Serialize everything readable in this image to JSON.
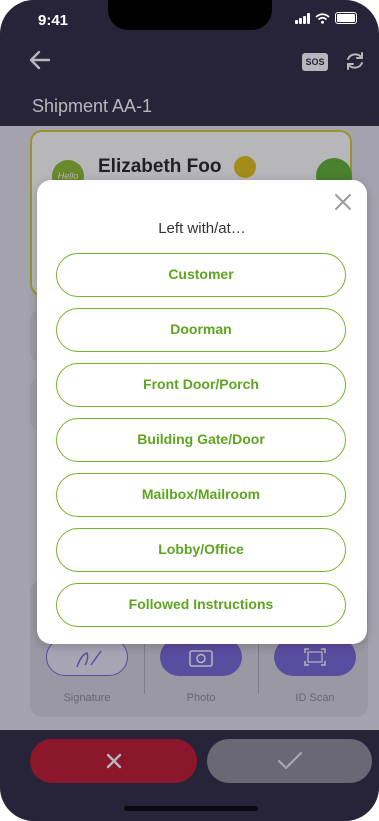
{
  "status_bar": {
    "time": "9:41"
  },
  "header": {
    "sos_label": "SOS",
    "title": "Shipment AA-1"
  },
  "customer": {
    "name": "Elizabeth Foo",
    "avatar_text": "Hello"
  },
  "actions": [
    {
      "label": "Signature",
      "icon": "pen-icon"
    },
    {
      "label": "Photo",
      "icon": "camera-icon"
    },
    {
      "label": "ID Scan",
      "icon": "scan-icon"
    }
  ],
  "footer": {
    "cancel_icon": "close-x-icon",
    "confirm_icon": "checkmark-icon"
  },
  "modal": {
    "title": "Left with/at…",
    "options": [
      "Customer",
      "Doorman",
      "Front Door/Porch",
      "Building Gate/Door",
      "Mailbox/Mailroom",
      "Lobby/Office",
      "Followed Instructions"
    ]
  },
  "colors": {
    "header_bg": "#2b2942",
    "accent_green": "#74b52d",
    "cancel_red": "#c0152d",
    "card_border": "#d6cc2a",
    "action_purple": "#7565d6"
  }
}
